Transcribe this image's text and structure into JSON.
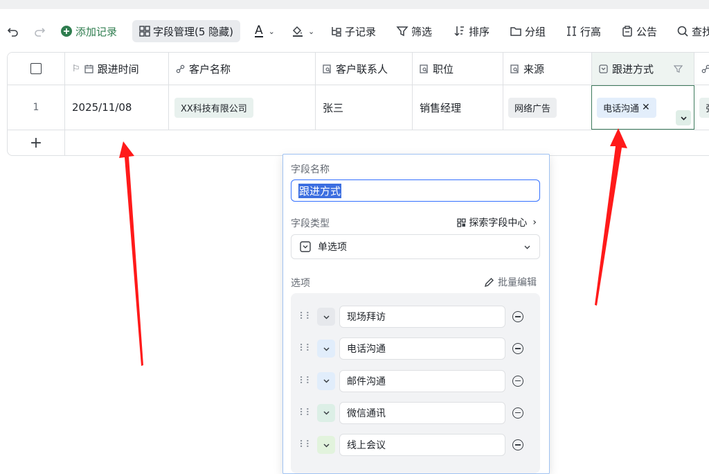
{
  "toolbar": {
    "add_record": "添加记录",
    "field_manage": "字段管理(5 隐藏)",
    "text_color_glyph": "A",
    "sub_record": "子记录",
    "filter": "筛选",
    "sort": "排序",
    "group": "分组",
    "row_height": "行高",
    "notice": "公告",
    "search": "查找"
  },
  "table": {
    "headers": [
      "跟进时间",
      "客户名称",
      "客户联系人",
      "职位",
      "来源",
      "跟进方式"
    ],
    "row": {
      "index": "1",
      "date": "2025/11/08",
      "company": "XX科技有限公司",
      "contact": "张三",
      "position": "销售经理",
      "source": "网络广告",
      "method": "电话沟通",
      "next_partial": "张"
    },
    "add_row_glyph": "+"
  },
  "popup": {
    "field_name_label": "字段名称",
    "field_name_value": "跟进方式",
    "field_type_label": "字段类型",
    "explore_link": "探索字段中心",
    "field_type_value": "单选项",
    "options_label": "选项",
    "batch_edit": "批量编辑",
    "options": [
      {
        "label": "现场拜访",
        "color": "#e6e8ec"
      },
      {
        "label": "电话沟通",
        "color": "#e1edfb"
      },
      {
        "label": "邮件沟通",
        "color": "#e1edfb"
      },
      {
        "label": "微信通讯",
        "color": "#dcefe6"
      },
      {
        "label": "线上会议",
        "color": "#e2f3dd"
      }
    ]
  },
  "colors": {
    "accent": "#3370ff",
    "arrow": "#ff1a1a",
    "tag_bg": "#e8f1ee",
    "active_cell_border": "#3d7a5c"
  }
}
